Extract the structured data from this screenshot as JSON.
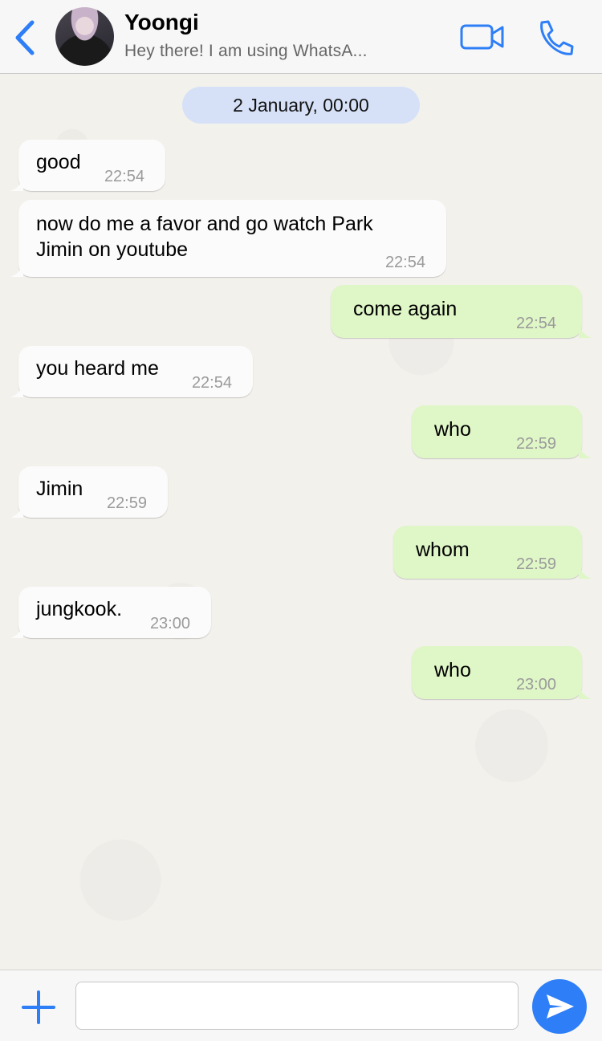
{
  "header": {
    "contact_name": "Yoongi",
    "status": "Hey there! I am using WhatsA...",
    "accent_color": "#2d7ef7"
  },
  "chat": {
    "date_separator": "2 January, 00:00",
    "messages": [
      {
        "direction": "in",
        "text": "good",
        "time": "22:54"
      },
      {
        "direction": "in",
        "text": "now do me a favor and go watch Park\nJimin on youtube",
        "time": "22:54"
      },
      {
        "direction": "out",
        "text": "come again",
        "time": "22:54"
      },
      {
        "direction": "in",
        "text": "you heard me",
        "time": "22:54"
      },
      {
        "direction": "out",
        "text": "who",
        "time": "22:59"
      },
      {
        "direction": "in",
        "text": "Jimin",
        "time": "22:59"
      },
      {
        "direction": "out",
        "text": "whom",
        "time": "22:59"
      },
      {
        "direction": "in",
        "text": "jungkook.",
        "time": "23:00"
      },
      {
        "direction": "out",
        "text": "who",
        "time": "23:00"
      }
    ],
    "incoming_bubble_color": "#fbfbfb",
    "outgoing_bubble_color": "#dff6c7"
  },
  "composer": {
    "input_value": "",
    "icons": [
      "plus-icon",
      "send-icon"
    ]
  }
}
